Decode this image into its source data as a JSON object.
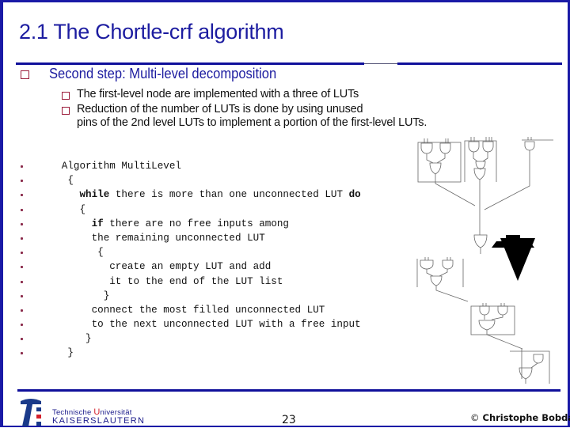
{
  "slide": {
    "title": "2.1 The Chortle-crf algorithm",
    "main_bullet": "Second step: Multi-level decomposition",
    "sub_bullets": [
      {
        "lines": [
          "The first-level node are implemented with a three of LUTs"
        ]
      },
      {
        "lines": [
          "Reduction of the number of LUTs is done by using unused",
          "pins of the 2nd level LUTs to implement a portion of the first-level LUTs."
        ]
      }
    ],
    "code": [
      {
        "indent": "     ",
        "kw": "",
        "text": "Algorithm MultiLevel",
        "kw_end": ""
      },
      {
        "indent": "      ",
        "kw": "",
        "text": "{",
        "kw_end": ""
      },
      {
        "indent": "        ",
        "kw": "while",
        "text": " there is more than one unconnected LUT ",
        "kw_end": "do"
      },
      {
        "indent": "        ",
        "kw": "",
        "text": "{",
        "kw_end": ""
      },
      {
        "indent": "          ",
        "kw": "if",
        "text": " there are no free inputs among",
        "kw_end": ""
      },
      {
        "indent": "          ",
        "kw": "",
        "text": "the remaining unconnected LUT",
        "kw_end": ""
      },
      {
        "indent": "           ",
        "kw": "",
        "text": "{",
        "kw_end": ""
      },
      {
        "indent": "             ",
        "kw": "",
        "text": "create an empty LUT and add",
        "kw_end": ""
      },
      {
        "indent": "             ",
        "kw": "",
        "text": "it to the end of the LUT list",
        "kw_end": ""
      },
      {
        "indent": "            ",
        "kw": "",
        "text": "}",
        "kw_end": ""
      },
      {
        "indent": "          ",
        "kw": "",
        "text": "connect the most filled unconnected LUT",
        "kw_end": ""
      },
      {
        "indent": "          ",
        "kw": "",
        "text": "to the next unconnected LUT with a free input",
        "kw_end": ""
      },
      {
        "indent": "         ",
        "kw": "",
        "text": "}",
        "kw_end": ""
      },
      {
        "indent": "      ",
        "kw": "",
        "text": "}",
        "kw_end": ""
      }
    ]
  },
  "footer": {
    "logo_line1_a": "Technische ",
    "logo_line1_u": "U",
    "logo_line1_b": "niversität",
    "logo_line2": "KAISERSLAUTERN",
    "page_number": "23",
    "copyright_symbol": "©",
    "author": "Christophe Bobda"
  },
  "colors": {
    "title": "#1c1ca0",
    "rule": "#0f0f9a",
    "bullet_border": "#9b1b3a",
    "logo_blue": "#1a3a8a",
    "logo_red": "#d3202b"
  }
}
